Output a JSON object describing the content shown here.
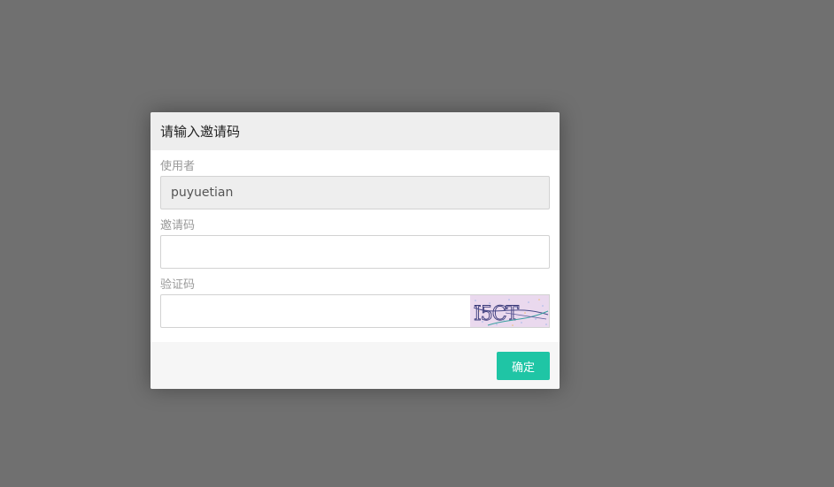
{
  "dialog": {
    "title": "请输入邀请码",
    "user_label": "使用者",
    "user_value": "puyuetian",
    "invite_label": "邀请码",
    "invite_value": "",
    "captcha_label": "验证码",
    "captcha_value": "",
    "captcha_text": "I5CT",
    "confirm_label": "确定"
  },
  "colors": {
    "overlay": "#707070",
    "header": "#eeeeee",
    "footer": "#f6f6f6",
    "accent": "#1fc5a5",
    "captcha_bg": "#ead9ee"
  }
}
